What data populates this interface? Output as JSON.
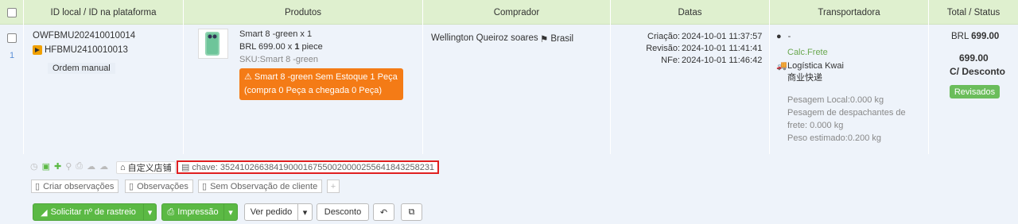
{
  "header": {
    "col_id": "ID local / ID na plataforma",
    "col_products": "Produtos",
    "col_buyer": "Comprador",
    "col_dates": "Datas",
    "col_carrier": "Transportadora",
    "col_total": "Total / Status"
  },
  "order": {
    "row_index": "1",
    "local_id": "OWFBMU202410010014",
    "platform_id": "HFBMU2410010013",
    "manual_order": "Ordem manual",
    "product": {
      "name": "Smart 8 -green x 1",
      "price_prefix": "BRL 699.00 x ",
      "qty": "1",
      "unit": " piece",
      "sku": "SKU:Smart 8 -green",
      "stock_warning": "Smart 8 -green Sem Estoque 1 Peça (compra 0 Peça a chegada 0 Peça)"
    },
    "buyer": {
      "name": "Wellington Queiroz soares",
      "country": "Brasil"
    },
    "dates": {
      "created_label": "Criação:",
      "created": "2024-10-01 11:37:57",
      "revised_label": "Revisão:",
      "revised": "2024-10-01 11:41:41",
      "nfe_label": "NFe:",
      "nfe": "2024-10-01 11:46:42"
    },
    "carrier": {
      "user": "-",
      "calc": "Calc.Frete",
      "name": "Logística Kwai 商业快递",
      "weight_local": "Pesagem Local:0.000 kg",
      "weight_dispatch": "Pesagem de despachantes de frete: 0.000 kg",
      "weight_estimated": "Peso estimado:0.200 kg"
    },
    "total": {
      "currency_total": "BRL",
      "total_value": "699.00",
      "discount_value": "699.00",
      "discount_label": "C/ Desconto",
      "status": "Revisados"
    },
    "store_tag": "自定义店铺",
    "chave": "chave: 35241026638419000167550020000255641843258231"
  },
  "observations": {
    "create": "Criar observações",
    "view": "Observações",
    "client": "Sem Observação de cliente"
  },
  "actions": {
    "tracking": "Solicitar nº de rastreio",
    "print": "Impressão",
    "view_order": "Ver pedido",
    "discount": "Desconto"
  },
  "colors": {
    "header_bg": "#dff0cf",
    "row_bg": "#eef3fa",
    "primary_green": "#5bb944",
    "warning_orange": "#f47b16",
    "highlight_red": "#e02020"
  }
}
